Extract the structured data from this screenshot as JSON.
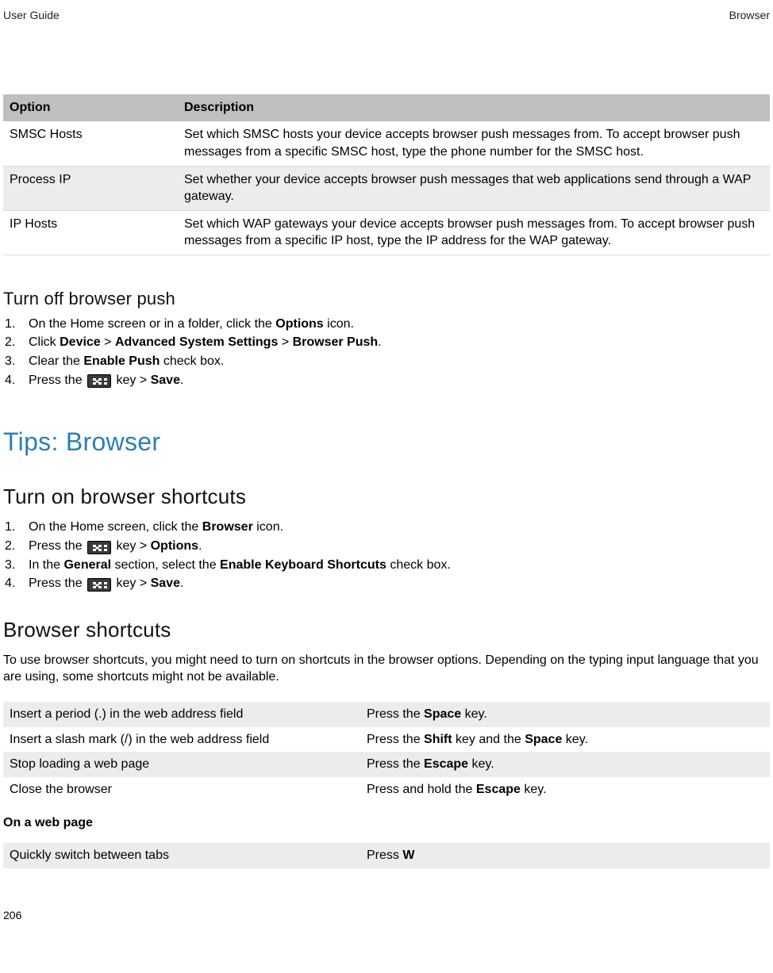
{
  "header": {
    "left": "User Guide",
    "right": "Browser"
  },
  "table1": {
    "headers": {
      "option": "Option",
      "description": "Description"
    },
    "rows": [
      {
        "option": "SMSC Hosts",
        "desc": "Set which SMSC hosts your device accepts browser push messages from. To accept browser push messages from a specific SMSC host, type the phone number for the SMSC host."
      },
      {
        "option": "Process IP",
        "desc": "Set whether your device accepts browser push messages that web applications send through a WAP gateway."
      },
      {
        "option": "IP Hosts",
        "desc": "Set which WAP gateways your device accepts browser push messages from. To accept browser push messages from a specific IP host, type the IP address for the WAP gateway."
      }
    ]
  },
  "turnOffPush": {
    "heading": "Turn off browser push",
    "s1_a": "On the Home screen or in a folder, click the ",
    "s1_b": "Options",
    "s1_c": " icon.",
    "s2_a": "Click ",
    "s2_b": "Device",
    "s2_c": " > ",
    "s2_d": "Advanced System Settings",
    "s2_e": " > ",
    "s2_f": "Browser Push",
    "s2_g": ".",
    "s3_a": "Clear the ",
    "s3_b": "Enable Push",
    "s3_c": " check box.",
    "s4_a": "Press the ",
    "s4_b": " key > ",
    "s4_c": "Save",
    "s4_d": "."
  },
  "tips": {
    "heading": "Tips: Browser"
  },
  "shortcutsOn": {
    "heading": "Turn on browser shortcuts",
    "s1_a": "On the Home screen, click the ",
    "s1_b": "Browser",
    "s1_c": " icon.",
    "s2_a": "Press the ",
    "s2_b": " key > ",
    "s2_c": "Options",
    "s2_d": ".",
    "s3_a": "In the ",
    "s3_b": "General",
    "s3_c": " section, select the ",
    "s3_d": "Enable Keyboard Shortcuts",
    "s3_e": " check box.",
    "s4_a": "Press the ",
    "s4_b": " key > ",
    "s4_c": "Save",
    "s4_d": "."
  },
  "browserShortcuts": {
    "heading": "Browser shortcuts",
    "intro": "To use browser shortcuts, you might need to turn on shortcuts in the browser options. Depending on the typing input language that you are using, some shortcuts might not be available."
  },
  "scTable1": {
    "r1": {
      "a": "Insert a period (.) in the web address field",
      "b1": "Press the ",
      "b2": "Space",
      "b3": " key."
    },
    "r2": {
      "a": "Insert a slash mark (/) in the web address field",
      "b1": "Press the ",
      "b2": "Shift",
      "b3": " key and the ",
      "b4": "Space",
      "b5": " key."
    },
    "r3": {
      "a": "Stop loading a web page",
      "b1": "Press the ",
      "b2": "Escape",
      "b3": " key."
    },
    "r4": {
      "a": "Close the browser",
      "b1": "Press and hold the ",
      "b2": "Escape",
      "b3": " key."
    }
  },
  "subhead": "On a web page",
  "scTable2": {
    "r1": {
      "a": "Quickly switch between tabs",
      "b1": "Press ",
      "b2": "W"
    }
  },
  "pageNumber": "206"
}
